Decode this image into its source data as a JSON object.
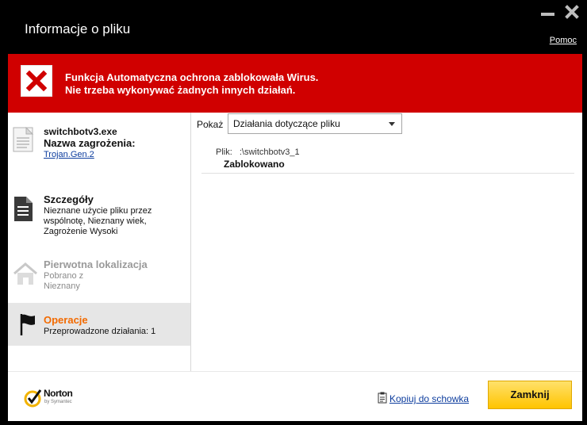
{
  "window": {
    "title": "Informacje o pliku",
    "help_link": "Pomoc"
  },
  "banner": {
    "line1": "Funkcja Automatyczna ochrona zablokowała Wirus.",
    "line2": "Nie trzeba wykonywać żadnych innych działań."
  },
  "sidebar": {
    "file": {
      "filename": "switchbotv3.exe",
      "threat_label": "Nazwa zagrożenia:",
      "threat_name": "Trojan.Gen.2"
    },
    "details": {
      "title": "Szczegóły",
      "line1": "Nieznane użycie pliku przez",
      "line2": "wspólnotę,  Nieznany wiek,",
      "line3": "Zagrożenie Wysoki"
    },
    "origin": {
      "title": "Pierwotna lokalizacja",
      "line1": "Pobrano z",
      "line2": " Nieznany"
    },
    "operations": {
      "title": "Operacje",
      "line1": "Przeprowadzone działania: 1"
    }
  },
  "main": {
    "show_label": "Pokaż",
    "filter_selected": "Działania dotyczące pliku",
    "file_label": "Plik:",
    "file_path": ":\\switchbotv3_1",
    "file_status": "Zablokowano"
  },
  "footer": {
    "copy_link": "Kopiuj do schowka",
    "close_button": "Zamknij",
    "brand": "Norton",
    "brand_sub": "by Symantec"
  },
  "colors": {
    "banner_red": "#d00000",
    "operations_orange": "#f26a00",
    "button_yellow": "#ffc400",
    "link_blue": "#0d3d9e"
  }
}
